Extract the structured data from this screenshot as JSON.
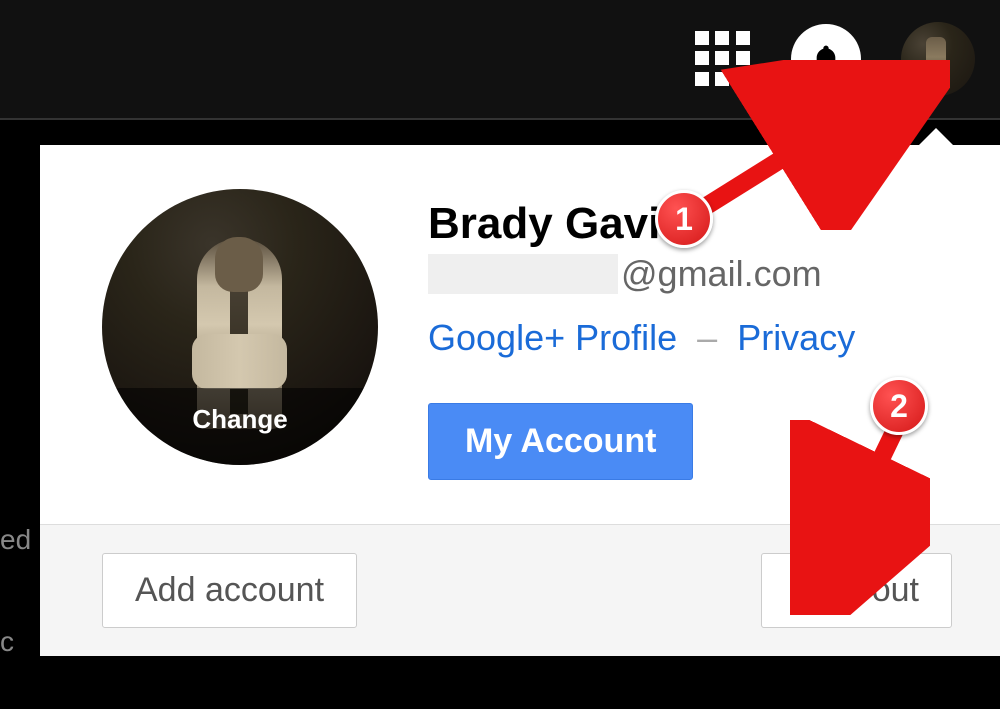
{
  "header": {
    "apps_icon": "apps-grid",
    "bell_icon": "bell",
    "avatar_icon": "user-avatar"
  },
  "dropdown": {
    "user_name": "Brady Gavin",
    "email_domain": "@gmail.com",
    "change_label": "Change",
    "google_plus_link": "Google+ Profile",
    "link_separator": "–",
    "privacy_link": "Privacy",
    "my_account_button": "My Account",
    "add_account_button": "Add account",
    "sign_out_button": "Sign out"
  },
  "callouts": {
    "badge_1": "1",
    "badge_2": "2"
  },
  "sidebar_fragments": {
    "f1": "ed",
    "f2": "c"
  },
  "colors": {
    "link_blue": "#1a6bd8",
    "button_blue": "#4a8bf5",
    "callout_red": "#d41717"
  }
}
